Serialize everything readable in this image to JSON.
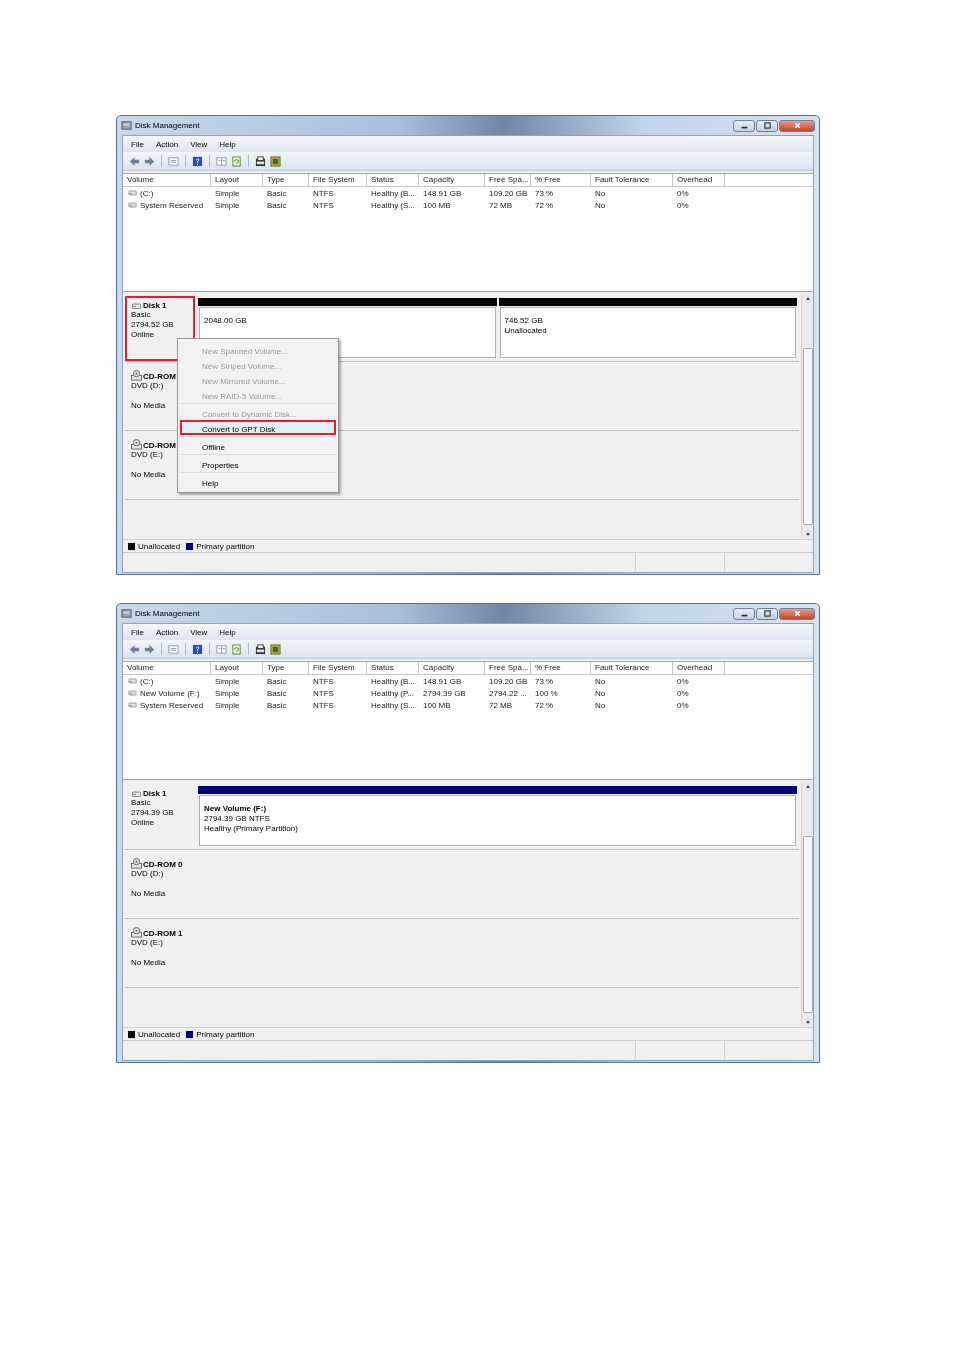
{
  "windows": [
    {
      "title": "Disk Management",
      "menu": [
        "File",
        "Action",
        "View",
        "Help"
      ],
      "columns": [
        "Volume",
        "Layout",
        "Type",
        "File System",
        "Status",
        "Capacity",
        "Free Spa...",
        "% Free",
        "Fault Tolerance",
        "Overhead"
      ],
      "volumes": [
        {
          "cells": [
            "(C:)",
            "Simple",
            "Basic",
            "NTFS",
            "Healthy (B...",
            "148.91 GB",
            "109.20 GB",
            "73 %",
            "No",
            "0%"
          ]
        },
        {
          "cells": [
            "System Reserved",
            "Simple",
            "Basic",
            "NTFS",
            "Healthy (S...",
            "100 MB",
            "72 MB",
            "72 %",
            "No",
            "0%"
          ]
        }
      ],
      "disks": [
        {
          "kind": "disk",
          "name": "Disk 1",
          "lines": [
            "Basic",
            "2794.52 GB",
            "Online"
          ],
          "highlighted": true,
          "partitions": [
            {
              "kind": "unallocated",
              "lines": [
                "2048.00 GB"
              ]
            },
            {
              "kind": "unallocated",
              "lines": [
                "746.52 GB",
                "Unallocated"
              ]
            }
          ]
        },
        {
          "kind": "cdrom",
          "name": "CD-ROM",
          "lines": [
            "DVD (D:)",
            "No Media"
          ],
          "highlighted": false
        },
        {
          "kind": "cdrom",
          "name": "CD-ROM",
          "lines": [
            "DVD (E:)",
            "No Media"
          ],
          "highlighted": false
        }
      ],
      "legend": [
        {
          "label": "Unallocated",
          "color": "#000000"
        },
        {
          "label": "Primary partition",
          "color": "#00007f"
        }
      ],
      "context_menu": {
        "groups": [
          [
            {
              "label": "New Spanned Volume...",
              "disabled": true,
              "highlighted": false
            },
            {
              "label": "New Striped Volume...",
              "disabled": true,
              "highlighted": false
            },
            {
              "label": "New Mirrored Volume...",
              "disabled": true,
              "highlighted": false
            },
            {
              "label": "New RAID-5 Volume...",
              "disabled": true,
              "highlighted": false
            }
          ],
          [
            {
              "label": "Convert to Dynamic Disk...",
              "disabled": true,
              "highlighted": false
            },
            {
              "label": "Convert to GPT Disk",
              "disabled": false,
              "highlighted": true
            }
          ],
          [
            {
              "label": "Offline",
              "disabled": false,
              "highlighted": false
            }
          ],
          [
            {
              "label": "Properties",
              "disabled": false,
              "highlighted": false
            }
          ],
          [
            {
              "label": "Help",
              "disabled": false,
              "highlighted": false
            }
          ]
        ]
      }
    },
    {
      "title": "Disk Management",
      "menu": [
        "File",
        "Action",
        "View",
        "Help"
      ],
      "columns": [
        "Volume",
        "Layout",
        "Type",
        "File System",
        "Status",
        "Capacity",
        "Free Spa...",
        "% Free",
        "Fault Tolerance",
        "Overhead"
      ],
      "volumes": [
        {
          "cells": [
            "(C:)",
            "Simple",
            "Basic",
            "NTFS",
            "Healthy (B...",
            "148.91 GB",
            "109.20 GB",
            "73 %",
            "No",
            "0%"
          ]
        },
        {
          "cells": [
            "New Volume (F:)",
            "Simple",
            "Basic",
            "NTFS",
            "Healthy (P...",
            "2794.39 GB",
            "2794.22 ...",
            "100 %",
            "No",
            "0%"
          ]
        },
        {
          "cells": [
            "System Reserved",
            "Simple",
            "Basic",
            "NTFS",
            "Healthy (S...",
            "100 MB",
            "72 MB",
            "72 %",
            "No",
            "0%"
          ]
        }
      ],
      "disks": [
        {
          "kind": "disk",
          "name": "Disk 1",
          "lines": [
            "Basic",
            "2794.39 GB",
            "Online"
          ],
          "highlighted": false,
          "partitions": [
            {
              "kind": "primary",
              "name": "New Volume  (F:)",
              "lines": [
                "2794.39 GB NTFS",
                "Healthy (Primary Partition)"
              ]
            }
          ]
        },
        {
          "kind": "cdrom",
          "name": "CD-ROM 0",
          "lines": [
            "DVD (D:)",
            "No Media"
          ],
          "highlighted": false
        },
        {
          "kind": "cdrom",
          "name": "CD-ROM 1",
          "lines": [
            "DVD (E:)",
            "No Media"
          ],
          "highlighted": false
        }
      ],
      "legend": [
        {
          "label": "Unallocated",
          "color": "#000000"
        },
        {
          "label": "Primary partition",
          "color": "#00007f"
        }
      ]
    }
  ]
}
